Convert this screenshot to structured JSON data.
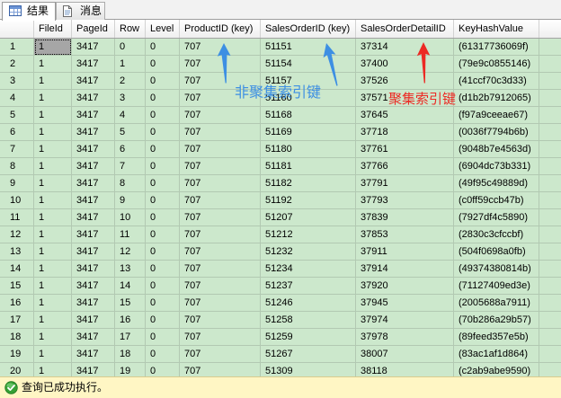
{
  "tabs": [
    {
      "label": "结果",
      "icon": "results-grid-icon",
      "selected": true
    },
    {
      "label": "消息",
      "icon": "messages-icon",
      "selected": false
    }
  ],
  "grid": {
    "columns": [
      "FileId",
      "PageId",
      "Row",
      "Level",
      "ProductID (key)",
      "SalesOrderID (key)",
      "SalesOrderDetailID",
      "KeyHashValue"
    ],
    "selected_cell": [
      0,
      0
    ],
    "rows": [
      {
        "number": "1",
        "values": [
          "1",
          "3417",
          "0",
          "0",
          "707",
          "51151",
          "37314",
          "(61317736069f)"
        ]
      },
      {
        "number": "2",
        "values": [
          "1",
          "3417",
          "1",
          "0",
          "707",
          "51154",
          "37400",
          "(79e9c0855146)"
        ]
      },
      {
        "number": "3",
        "values": [
          "1",
          "3417",
          "2",
          "0",
          "707",
          "51157",
          "37526",
          "(41ccf70c3d33)"
        ]
      },
      {
        "number": "4",
        "values": [
          "1",
          "3417",
          "3",
          "0",
          "707",
          "51160",
          "37571",
          "(d1b2b7912065)"
        ]
      },
      {
        "number": "5",
        "values": [
          "1",
          "3417",
          "4",
          "0",
          "707",
          "51168",
          "37645",
          "(f97a9ceeae67)"
        ]
      },
      {
        "number": "6",
        "values": [
          "1",
          "3417",
          "5",
          "0",
          "707",
          "51169",
          "37718",
          "(0036f7794b6b)"
        ]
      },
      {
        "number": "7",
        "values": [
          "1",
          "3417",
          "6",
          "0",
          "707",
          "51180",
          "37761",
          "(9048b7e4563d)"
        ]
      },
      {
        "number": "8",
        "values": [
          "1",
          "3417",
          "7",
          "0",
          "707",
          "51181",
          "37766",
          "(6904dc73b331)"
        ]
      },
      {
        "number": "9",
        "values": [
          "1",
          "3417",
          "8",
          "0",
          "707",
          "51182",
          "37791",
          "(49f95c49889d)"
        ]
      },
      {
        "number": "10",
        "values": [
          "1",
          "3417",
          "9",
          "0",
          "707",
          "51192",
          "37793",
          "(c0ff59ccb47b)"
        ]
      },
      {
        "number": "11",
        "values": [
          "1",
          "3417",
          "10",
          "0",
          "707",
          "51207",
          "37839",
          "(7927df4c5890)"
        ]
      },
      {
        "number": "12",
        "values": [
          "1",
          "3417",
          "11",
          "0",
          "707",
          "51212",
          "37853",
          "(2830c3cfccbf)"
        ]
      },
      {
        "number": "13",
        "values": [
          "1",
          "3417",
          "12",
          "0",
          "707",
          "51232",
          "37911",
          "(504f0698a0fb)"
        ]
      },
      {
        "number": "14",
        "values": [
          "1",
          "3417",
          "13",
          "0",
          "707",
          "51234",
          "37914",
          "(49374380814b)"
        ]
      },
      {
        "number": "15",
        "values": [
          "1",
          "3417",
          "14",
          "0",
          "707",
          "51237",
          "37920",
          "(71127409ed3e)"
        ]
      },
      {
        "number": "16",
        "values": [
          "1",
          "3417",
          "15",
          "0",
          "707",
          "51246",
          "37945",
          "(2005688a7911)"
        ]
      },
      {
        "number": "17",
        "values": [
          "1",
          "3417",
          "16",
          "0",
          "707",
          "51258",
          "37974",
          "(70b286a29b57)"
        ]
      },
      {
        "number": "18",
        "values": [
          "1",
          "3417",
          "17",
          "0",
          "707",
          "51259",
          "37978",
          "(89feed357e5b)"
        ]
      },
      {
        "number": "19",
        "values": [
          "1",
          "3417",
          "18",
          "0",
          "707",
          "51267",
          "38007",
          "(83ac1af1d864)"
        ]
      },
      {
        "number": "20",
        "values": [
          "1",
          "3417",
          "19",
          "0",
          "707",
          "51309",
          "38118",
          "(c2ab9abe9590)"
        ]
      }
    ]
  },
  "annotations": {
    "nonclustered_index_key": "非聚集索引键",
    "clustered_index_key": "聚集索引键"
  },
  "status": {
    "icon": "success-check-icon",
    "text": "查询已成功执行。"
  },
  "colors": {
    "row_background": "#CCE8CC",
    "grid_line": "#B2C9B2",
    "header_line": "#A3A3A3",
    "selected_cell": "#A6A6A6",
    "status_background": "#FFF6C4",
    "nonclustered_annotation": "#3D8FE3",
    "clustered_annotation": "#EC2A24"
  }
}
